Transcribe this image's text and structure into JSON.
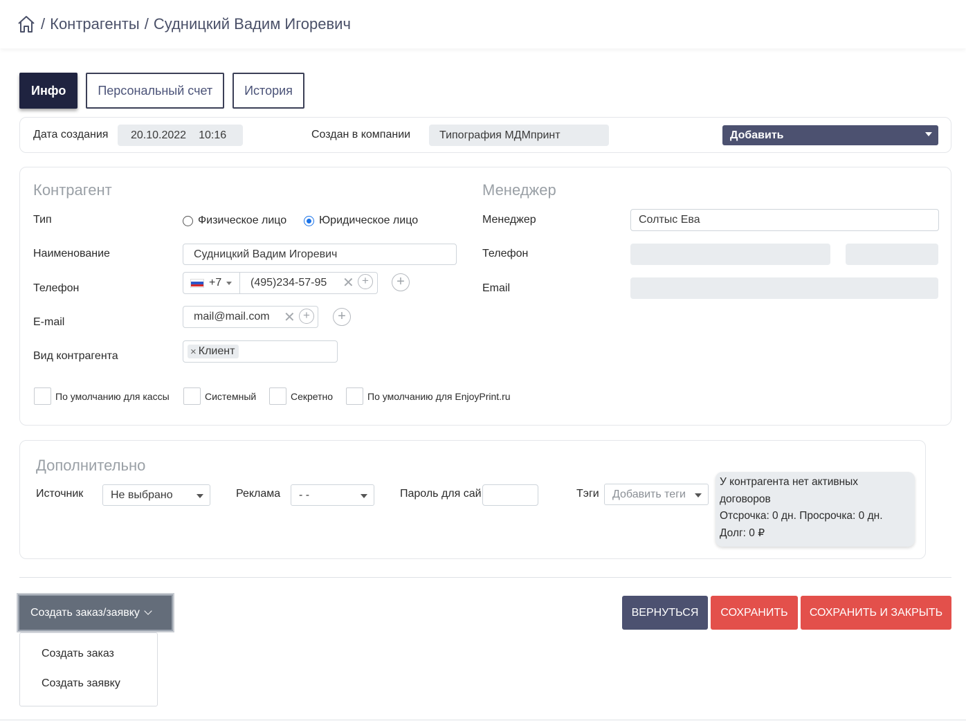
{
  "breadcrumb": {
    "home_icon": "home-icon",
    "separator": "/",
    "items": [
      "Контрагенты",
      "Судницкий Вадим Игоревич"
    ]
  },
  "tabs": [
    {
      "label": "Инфо",
      "active": true
    },
    {
      "label": "Персональный счет",
      "active": false
    },
    {
      "label": "История",
      "active": false
    }
  ],
  "infobar": {
    "created_label": "Дата создания",
    "created_date": "20.10.2022",
    "created_time": "10:16",
    "company_label": "Создан в компании",
    "company_value": "Типография МДМпринт",
    "add_dropdown": "Добавить"
  },
  "counterparty": {
    "title": "Контрагент",
    "type_label": "Тип",
    "type_options": [
      "Физическое лицо",
      "Юридическое лицо"
    ],
    "type_selected": "Юридическое лицо",
    "name_label": "Наименование",
    "name_value": "Судницкий Вадим Игоревич",
    "phone_label": "Телефон",
    "phone_code": "+7",
    "phone_value": "(495)234-57-95",
    "email_label": "E-mail",
    "email_value": "mail@mail.com",
    "kind_label": "Вид контрагента",
    "kind_tag": "Клиент",
    "kind_tag_remove": "×",
    "checkboxes": [
      "По умолчанию для кассы",
      "Системный",
      "Секретно",
      "По умолчанию для EnjoyPrint.ru"
    ]
  },
  "manager": {
    "title": "Менеджер",
    "manager_label": "Менеджер",
    "manager_value": "Солтыс Ева",
    "phone_label": "Телефон",
    "email_label": "Email"
  },
  "extra": {
    "title": "Дополнительно",
    "source_label": "Источник",
    "source_value": "Не выбрано",
    "ads_label": "Реклама",
    "ads_value": "- -",
    "password_label": "Пароль для сай",
    "tags_label": "Тэги",
    "tags_placeholder": "Добавить теги",
    "contract_line1": "У контрагента нет активных",
    "contract_line2": "договоров",
    "contract_line3": "Отсрочка: 0 дн. Просрочка: 0 дн.",
    "contract_line4": "Долг: 0 ₽"
  },
  "footer": {
    "create_button": "Создать заказ/заявку",
    "menu_items": [
      "Создать заказ",
      "Создать заявку"
    ],
    "back_button": "ВЕРНУТЬСЯ",
    "save_button": "СОХРАНИТЬ",
    "save_close_button": "СОХРАНИТЬ И ЗАКРЫТЬ"
  },
  "colors": {
    "dark_navy": "#1f2340",
    "slate": "#4c5170",
    "danger": "#e3504b",
    "field_gray": "#e9ecef"
  }
}
